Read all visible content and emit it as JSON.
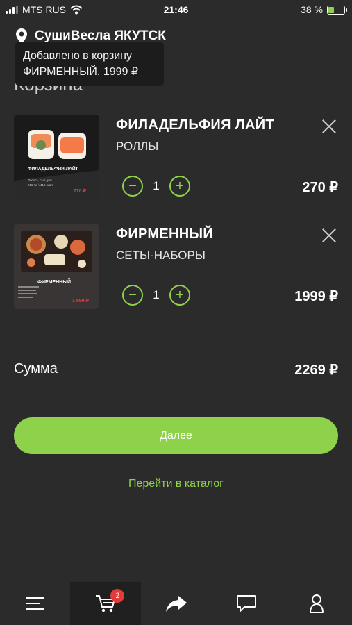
{
  "status_bar": {
    "carrier": "MTS RUS",
    "time": "21:46",
    "battery": "38 %",
    "battery_level": 0.38
  },
  "header": {
    "location": "СушиВесла ЯКУТСК",
    "title": "Корзина"
  },
  "toast": {
    "line1": "Добавлено в корзину",
    "line2": "ФИРМЕННЫЙ, 1999 ₽"
  },
  "cart": {
    "items": [
      {
        "name": "ФИЛАДЕЛЬФИЯ ЛАЙТ",
        "category": "РОЛЛЫ",
        "quantity": "1",
        "price": "270 ₽",
        "thumb_title": "ФИЛАДЕЛЬФИЯ ЛАЙТ",
        "thumb_desc": "Лосось, сыр, рис",
        "thumb_meta": "210 гр. \\ 418 ккал",
        "thumb_price": "270 ₽"
      },
      {
        "name": "ФИРМЕННЫЙ",
        "category": "СЕТЫ-НАБОРЫ",
        "quantity": "1",
        "price": "1999 ₽",
        "thumb_title": "ФИРМЕННЫЙ",
        "thumb_price": "1 999 ₽"
      }
    ],
    "minus_label": "−",
    "plus_label": "+"
  },
  "summary": {
    "label": "Сумма",
    "value": "2269 ₽"
  },
  "actions": {
    "next_label": "Далее",
    "catalog_link": "Перейти в каталог"
  },
  "tabbar": {
    "cart_badge": "2",
    "tabs": [
      "menu-icon",
      "cart-icon",
      "share-icon",
      "chat-icon",
      "profile-icon"
    ]
  },
  "colors": {
    "accent": "#8ed14b",
    "background": "#2b2b2b",
    "badge": "#e23b3b"
  }
}
